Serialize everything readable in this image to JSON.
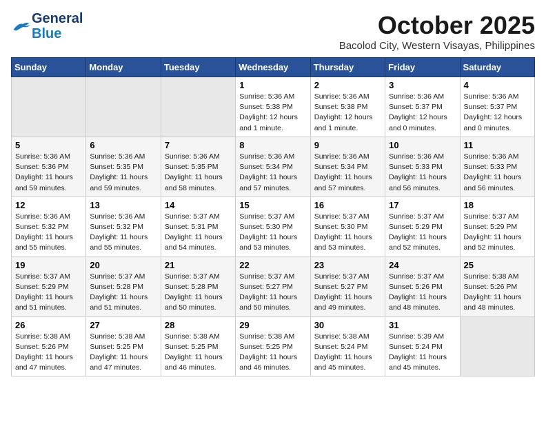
{
  "logo": {
    "part1": "General",
    "part2": "Blue"
  },
  "title": "October 2025",
  "location": "Bacolod City, Western Visayas, Philippines",
  "days_header": [
    "Sunday",
    "Monday",
    "Tuesday",
    "Wednesday",
    "Thursday",
    "Friday",
    "Saturday"
  ],
  "weeks": [
    [
      {
        "day": "",
        "info": ""
      },
      {
        "day": "",
        "info": ""
      },
      {
        "day": "",
        "info": ""
      },
      {
        "day": "1",
        "info": "Sunrise: 5:36 AM\nSunset: 5:38 PM\nDaylight: 12 hours\nand 1 minute."
      },
      {
        "day": "2",
        "info": "Sunrise: 5:36 AM\nSunset: 5:38 PM\nDaylight: 12 hours\nand 1 minute."
      },
      {
        "day": "3",
        "info": "Sunrise: 5:36 AM\nSunset: 5:37 PM\nDaylight: 12 hours\nand 0 minutes."
      },
      {
        "day": "4",
        "info": "Sunrise: 5:36 AM\nSunset: 5:37 PM\nDaylight: 12 hours\nand 0 minutes."
      }
    ],
    [
      {
        "day": "5",
        "info": "Sunrise: 5:36 AM\nSunset: 5:36 PM\nDaylight: 11 hours\nand 59 minutes."
      },
      {
        "day": "6",
        "info": "Sunrise: 5:36 AM\nSunset: 5:35 PM\nDaylight: 11 hours\nand 59 minutes."
      },
      {
        "day": "7",
        "info": "Sunrise: 5:36 AM\nSunset: 5:35 PM\nDaylight: 11 hours\nand 58 minutes."
      },
      {
        "day": "8",
        "info": "Sunrise: 5:36 AM\nSunset: 5:34 PM\nDaylight: 11 hours\nand 57 minutes."
      },
      {
        "day": "9",
        "info": "Sunrise: 5:36 AM\nSunset: 5:34 PM\nDaylight: 11 hours\nand 57 minutes."
      },
      {
        "day": "10",
        "info": "Sunrise: 5:36 AM\nSunset: 5:33 PM\nDaylight: 11 hours\nand 56 minutes."
      },
      {
        "day": "11",
        "info": "Sunrise: 5:36 AM\nSunset: 5:33 PM\nDaylight: 11 hours\nand 56 minutes."
      }
    ],
    [
      {
        "day": "12",
        "info": "Sunrise: 5:36 AM\nSunset: 5:32 PM\nDaylight: 11 hours\nand 55 minutes."
      },
      {
        "day": "13",
        "info": "Sunrise: 5:36 AM\nSunset: 5:32 PM\nDaylight: 11 hours\nand 55 minutes."
      },
      {
        "day": "14",
        "info": "Sunrise: 5:37 AM\nSunset: 5:31 PM\nDaylight: 11 hours\nand 54 minutes."
      },
      {
        "day": "15",
        "info": "Sunrise: 5:37 AM\nSunset: 5:30 PM\nDaylight: 11 hours\nand 53 minutes."
      },
      {
        "day": "16",
        "info": "Sunrise: 5:37 AM\nSunset: 5:30 PM\nDaylight: 11 hours\nand 53 minutes."
      },
      {
        "day": "17",
        "info": "Sunrise: 5:37 AM\nSunset: 5:29 PM\nDaylight: 11 hours\nand 52 minutes."
      },
      {
        "day": "18",
        "info": "Sunrise: 5:37 AM\nSunset: 5:29 PM\nDaylight: 11 hours\nand 52 minutes."
      }
    ],
    [
      {
        "day": "19",
        "info": "Sunrise: 5:37 AM\nSunset: 5:29 PM\nDaylight: 11 hours\nand 51 minutes."
      },
      {
        "day": "20",
        "info": "Sunrise: 5:37 AM\nSunset: 5:28 PM\nDaylight: 11 hours\nand 51 minutes."
      },
      {
        "day": "21",
        "info": "Sunrise: 5:37 AM\nSunset: 5:28 PM\nDaylight: 11 hours\nand 50 minutes."
      },
      {
        "day": "22",
        "info": "Sunrise: 5:37 AM\nSunset: 5:27 PM\nDaylight: 11 hours\nand 50 minutes."
      },
      {
        "day": "23",
        "info": "Sunrise: 5:37 AM\nSunset: 5:27 PM\nDaylight: 11 hours\nand 49 minutes."
      },
      {
        "day": "24",
        "info": "Sunrise: 5:37 AM\nSunset: 5:26 PM\nDaylight: 11 hours\nand 48 minutes."
      },
      {
        "day": "25",
        "info": "Sunrise: 5:38 AM\nSunset: 5:26 PM\nDaylight: 11 hours\nand 48 minutes."
      }
    ],
    [
      {
        "day": "26",
        "info": "Sunrise: 5:38 AM\nSunset: 5:26 PM\nDaylight: 11 hours\nand 47 minutes."
      },
      {
        "day": "27",
        "info": "Sunrise: 5:38 AM\nSunset: 5:25 PM\nDaylight: 11 hours\nand 47 minutes."
      },
      {
        "day": "28",
        "info": "Sunrise: 5:38 AM\nSunset: 5:25 PM\nDaylight: 11 hours\nand 46 minutes."
      },
      {
        "day": "29",
        "info": "Sunrise: 5:38 AM\nSunset: 5:25 PM\nDaylight: 11 hours\nand 46 minutes."
      },
      {
        "day": "30",
        "info": "Sunrise: 5:38 AM\nSunset: 5:24 PM\nDaylight: 11 hours\nand 45 minutes."
      },
      {
        "day": "31",
        "info": "Sunrise: 5:39 AM\nSunset: 5:24 PM\nDaylight: 11 hours\nand 45 minutes."
      },
      {
        "day": "",
        "info": ""
      }
    ]
  ]
}
